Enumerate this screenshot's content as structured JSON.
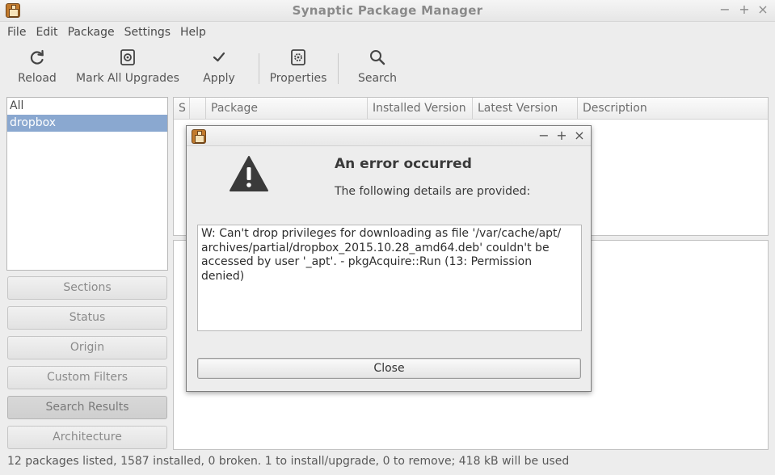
{
  "window": {
    "title": "Synaptic Package Manager",
    "controls": {
      "minimize": "−",
      "maximize": "+",
      "close": "×"
    }
  },
  "menu": [
    "File",
    "Edit",
    "Package",
    "Settings",
    "Help"
  ],
  "toolbar": {
    "reload": "Reload",
    "mark_all_upgrades": "Mark All Upgrades",
    "apply": "Apply",
    "properties": "Properties",
    "search": "Search"
  },
  "filters": [
    "All",
    "dropbox"
  ],
  "selected_filter": "dropbox",
  "side_buttons": [
    "Sections",
    "Status",
    "Origin",
    "Custom Filters",
    "Search Results",
    "Architecture"
  ],
  "active_side_button": "Search Results",
  "table": {
    "columns": [
      "S",
      "Package",
      "Installed Version",
      "Latest Version",
      "Description"
    ]
  },
  "status_bar": "12 packages listed, 1587 installed, 0 broken. 1 to install/upgrade, 0 to remove; 418 kB will be used",
  "dialog": {
    "heading": "An error occurred",
    "subheading": "The following details are provided:",
    "message_lines": [
      "W: Can't drop privileges for downloading as file '/var/cache/apt/",
      "archives/partial/dropbox_2015.10.28_amd64.deb' couldn't be",
      "accessed by user '_apt'. - pkgAcquire::Run (13: Permission denied)"
    ],
    "close_button": "Close",
    "controls": {
      "minimize": "−",
      "maximize": "+",
      "close": "×"
    }
  },
  "icons": {
    "app": "synaptic-package-icon",
    "reload": "reload-icon",
    "mark_all_upgrades": "mark-upgrades-icon",
    "apply": "checkmark-icon",
    "properties": "properties-gear-icon",
    "search": "search-magnifier-icon",
    "warning": "warning-triangle-icon"
  }
}
